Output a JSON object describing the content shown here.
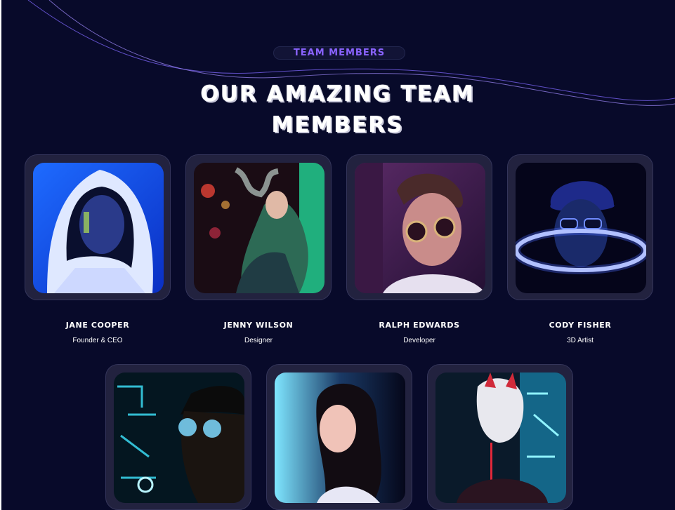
{
  "section": {
    "badge": "TEAM MEMBERS",
    "title_line1": "OUR AMAZING TEAM",
    "title_line2": "MEMBERS"
  },
  "members": [
    {
      "name": "JANE COOPER",
      "role": "Founder & CEO",
      "photo": "portrait-hood-blue"
    },
    {
      "name": "JENNY WILSON",
      "role": "Designer",
      "photo": "portrait-neon-green-smoke"
    },
    {
      "name": "RALPH EDWARDS",
      "role": "Developer",
      "photo": "portrait-round-glasses-purple"
    },
    {
      "name": "CODY FISHER",
      "role": "3D Artist",
      "photo": "portrait-neon-ring-glasses"
    },
    {
      "name": "",
      "role": "",
      "photo": "portrait-cap-sunglasses-neon"
    },
    {
      "name": "",
      "role": "",
      "photo": "portrait-girl-neon-light"
    },
    {
      "name": "",
      "role": "",
      "photo": "portrait-kitsune-mask"
    }
  ],
  "colors": {
    "background": "#080a2a",
    "accent": "#8a63ff",
    "card": "#22223f"
  }
}
